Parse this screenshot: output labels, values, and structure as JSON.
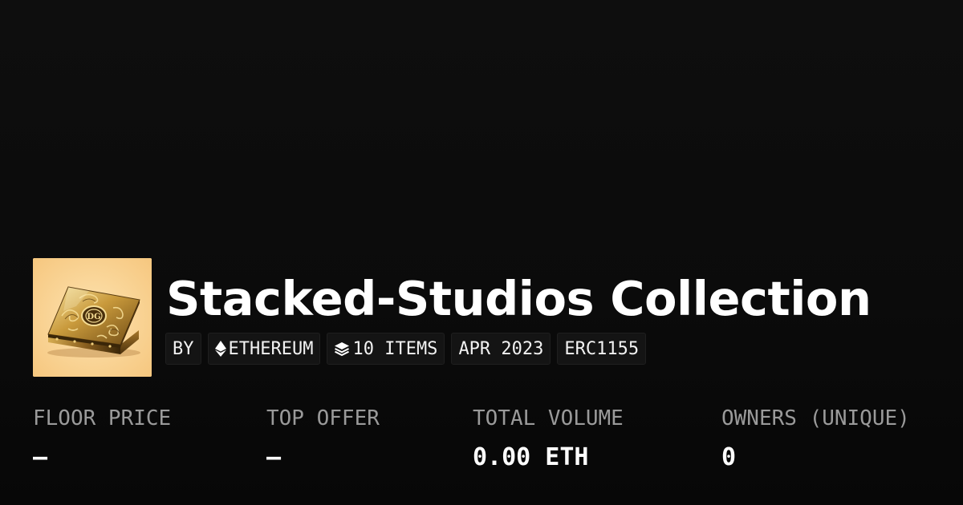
{
  "collection": {
    "title": "Stacked-Studios Collection",
    "thumbnail_icon": "ornate-gold-box-image",
    "colors": {
      "background": "#0b0b0b",
      "thumbnail_background": "#fbd79b",
      "tag_background": "#141414",
      "label": "#9a9a9a"
    }
  },
  "tags": {
    "by": "BY",
    "chain": "ETHEREUM",
    "chain_icon": "ethereum-icon",
    "items": "10 ITEMS",
    "items_icon": "layers-icon",
    "date": "APR 2023",
    "standard": "ERC1155"
  },
  "stats": [
    {
      "label": "FLOOR PRICE",
      "value": "–"
    },
    {
      "label": "TOP OFFER",
      "value": "–"
    },
    {
      "label": "TOTAL VOLUME",
      "value": "0.00 ETH"
    },
    {
      "label": "OWNERS (UNIQUE)",
      "value": "0"
    }
  ]
}
